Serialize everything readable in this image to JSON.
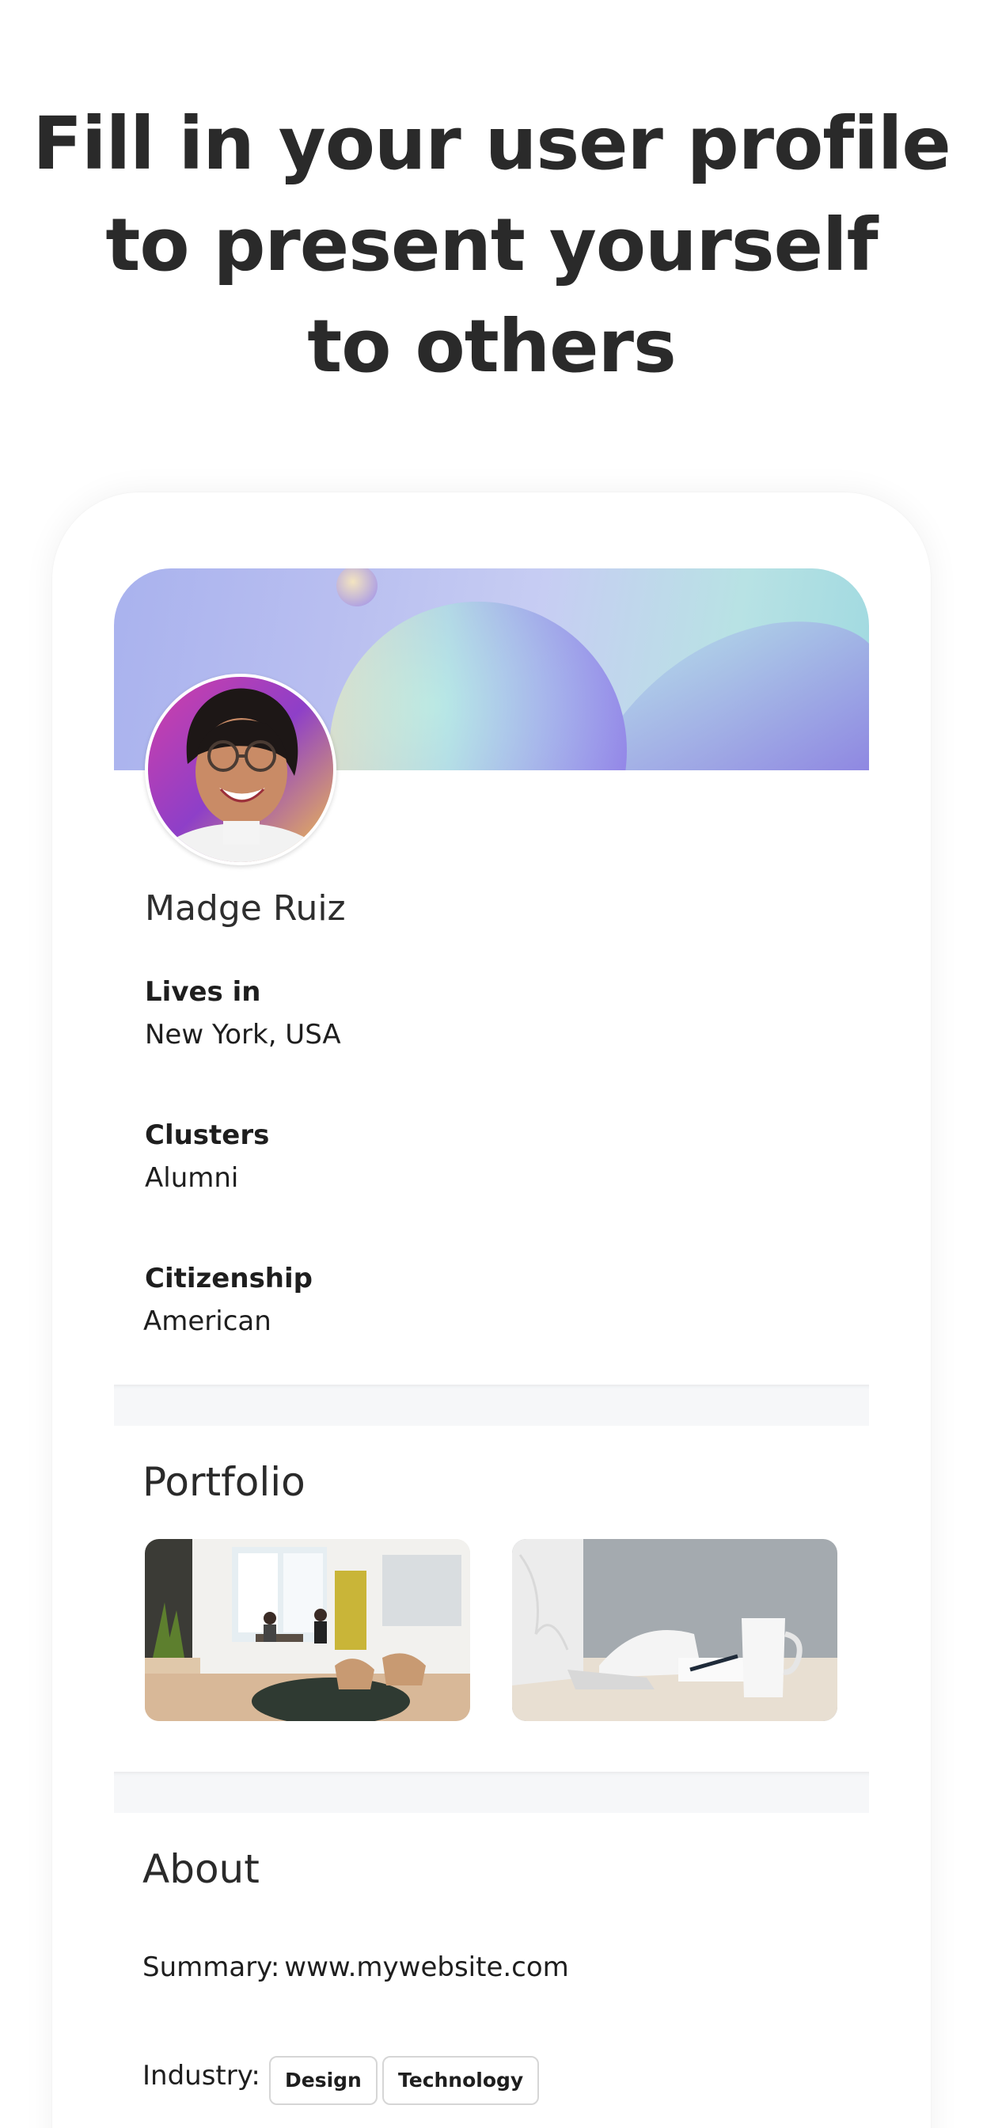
{
  "headline": {
    "line1": "Fill in your user profile",
    "line2": "to present yourself",
    "line3": "to others"
  },
  "profile": {
    "name": "Madge Ruiz",
    "fields": [
      {
        "label": "Lives in",
        "value": "New York, USA"
      },
      {
        "label": "Clusters",
        "value": "Alumni"
      },
      {
        "label": "Citizenship",
        "value": "American"
      }
    ]
  },
  "portfolio": {
    "title": "Portfolio",
    "images": [
      {
        "icon": "office-interior-photo"
      },
      {
        "icon": "laptop-desk-photo"
      }
    ]
  },
  "about": {
    "title": "About",
    "summary_label": "Summary:",
    "summary_value": "www.mywebsite.com",
    "industry_label": "Industry:",
    "industry_tags": [
      "Design",
      "Technology"
    ]
  },
  "colors": {
    "text": "#2a2a2a",
    "divider": "#f6f7f9",
    "cover_purple": "#8f7ce6",
    "cover_teal": "#a9e0e2"
  }
}
